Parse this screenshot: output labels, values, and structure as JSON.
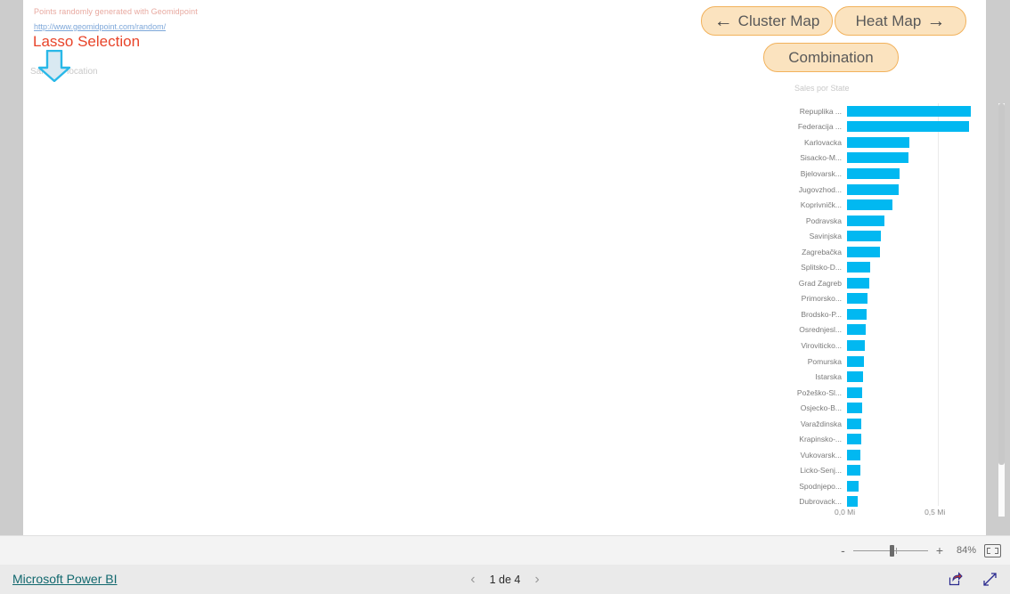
{
  "annotation": {
    "note": "Points randomly generated with Geomidpoint",
    "link": "http://www.geomidpoint.com/random/",
    "title": "Lasso Selection",
    "subtitle": "Sales by location",
    "arrow_color": "#29b8e8",
    "title_color": "#e8442a"
  },
  "nav_buttons": {
    "cluster": {
      "label": "Cluster Map",
      "arrow": "←"
    },
    "heat": {
      "label": "Heat Map",
      "arrow": "→"
    },
    "combination": {
      "label": "Combination"
    },
    "fill_color": "#fbe3bf",
    "border_color": "#f2b25c"
  },
  "chart_data": {
    "type": "bar",
    "orientation": "horizontal",
    "title": "Sales por State",
    "xlabel": "",
    "ylabel": "",
    "bar_color": "#01b8f1",
    "xlim": [
      0,
      0.72
    ],
    "xticks": [
      0,
      0.5
    ],
    "xtick_labels": [
      "0,0 Mi",
      "0,5 Mi"
    ],
    "grid": true,
    "legend": false,
    "categories": [
      "Repuplika ...",
      "Federacija ...",
      "Karlovacka",
      "Sisacko-M...",
      "Bjelovarsk...",
      "Jugovzhod...",
      "Koprivničk...",
      "Podravska",
      "Savinjska",
      "Zagrebačka",
      "Splitsko-D...",
      "Grad Zagreb",
      "Primorsko...",
      "Brodsko-P...",
      "Osrednjesl...",
      "Viroviticko...",
      "Pomurska",
      "Istarska",
      "Požeško-Sl...",
      "Osjecko-B...",
      "Varaždinska",
      "Krapinsko-...",
      "Vukovarsk...",
      "Licko-Senj...",
      "Spodnjepo...",
      "Dubrovack..."
    ],
    "values": [
      0.68,
      0.67,
      0.345,
      0.34,
      0.29,
      0.285,
      0.25,
      0.205,
      0.185,
      0.18,
      0.125,
      0.12,
      0.115,
      0.11,
      0.105,
      0.1,
      0.092,
      0.09,
      0.085,
      0.082,
      0.08,
      0.078,
      0.075,
      0.072,
      0.062,
      0.058
    ]
  },
  "toolbar": {
    "zoom_out_label": "-",
    "zoom_in_label": "+",
    "zoom_level": "84%"
  },
  "footer": {
    "brand": "Microsoft Power BI",
    "prev_label": "‹",
    "next_label": "›",
    "page_label": "1 de 4"
  }
}
